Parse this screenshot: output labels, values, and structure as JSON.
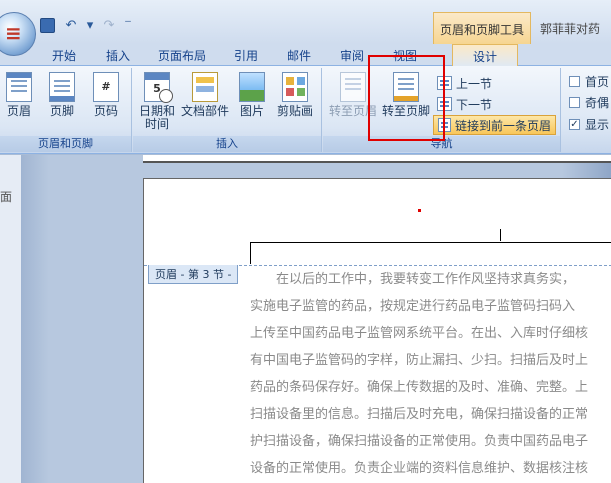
{
  "window": {
    "tool_group_title": "页眉和页脚工具",
    "doc_title": "郭菲菲对药",
    "orb_glyph": "≡"
  },
  "quick_access": {
    "undo_glyph": "↶",
    "redo_glyph": "↷",
    "dropdown_glyph": "▾",
    "customize_glyph": "‾"
  },
  "tabs": [
    {
      "label": "开始"
    },
    {
      "label": "插入"
    },
    {
      "label": "页面布局"
    },
    {
      "label": "引用"
    },
    {
      "label": "邮件"
    },
    {
      "label": "审阅"
    },
    {
      "label": "视图"
    },
    {
      "label": "设计"
    }
  ],
  "ribbon": {
    "header_footer_group": {
      "label": "页眉和页脚",
      "header_label": "页眉",
      "footer_label": "页脚",
      "page_number_label": "页码",
      "page_number_glyph": "#"
    },
    "insert_group": {
      "label": "插入",
      "date_time_label_1": "日期和",
      "date_time_label_2": "时间",
      "date_glyph": "5",
      "doc_parts_label": "文档部件",
      "picture_label": "图片",
      "clipart_label": "剪贴画"
    },
    "nav_group": {
      "label": "导航",
      "goto_header_label": "转至页眉",
      "goto_footer_label": "转至页脚",
      "prev_section_label": "上一节",
      "next_section_label": "下一节",
      "link_previous_label": "链接到前一条页眉"
    },
    "options": [
      {
        "label": "首页",
        "checked": false
      },
      {
        "label": "奇偶",
        "checked": false
      },
      {
        "label": "显示",
        "checked": true
      }
    ]
  },
  "document": {
    "left_strip_char": "面",
    "section_tag": "页眉 - 第 3 节 -",
    "body_lines": [
      "　　在以后的工作中，我要转变工作作风坚持求真务实，",
      "实施电子监管的药品，按规定进行药品电子监管码扫码入",
      "上传至中国药品电子监管网系统平台。在出、入库时仔细核",
      "有中国电子监管码的字样，防止漏扫、少扫。扫描后及时上",
      "药品的条码保存好。确保上传数据的及时、准确、完整。上",
      "扫描设备里的信息。扫描后及时充电，确保扫描设备的正常",
      "护扫描设备，确保扫描设备的正常使用。负责中国药品电子",
      "设备的正常使用。负责企业端的资料信息维护、数据核注核"
    ]
  }
}
